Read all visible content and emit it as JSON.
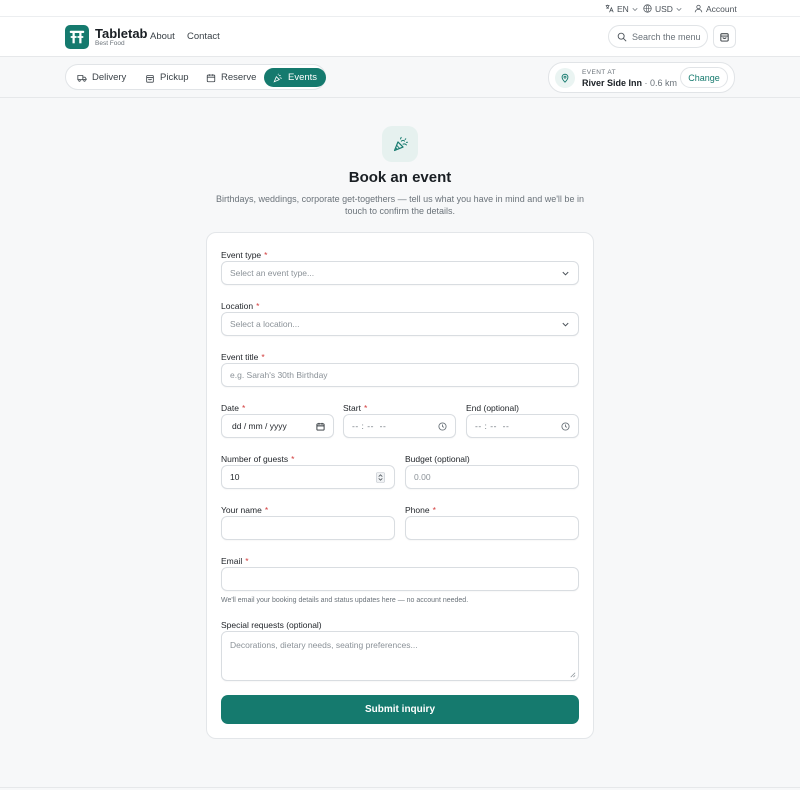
{
  "utility": {
    "language": "EN",
    "currency": "USD",
    "account": "Account"
  },
  "header": {
    "brand_name": "Tabletab",
    "brand_tagline": "Best Food",
    "nav": [
      "About",
      "Contact"
    ],
    "search_placeholder": "Search the menu"
  },
  "modes": {
    "tabs": [
      "Delivery",
      "Pickup",
      "Reserve",
      "Events"
    ],
    "active": "Events"
  },
  "location_card": {
    "label": "EVENT AT",
    "name": "River Side Inn",
    "distance": "· 0.6 km",
    "change_label": "Change"
  },
  "hero": {
    "title": "Book an event",
    "subtitle": "Birthdays, weddings, corporate get-togethers — tell us what you have in mind and we'll be in touch to confirm the details."
  },
  "form": {
    "event_type": {
      "label": "Event type",
      "placeholder": "Select an event type..."
    },
    "location": {
      "label": "Location",
      "placeholder": "Select a location..."
    },
    "event_title": {
      "label": "Event title",
      "placeholder": "e.g. Sarah's 30th Birthday"
    },
    "date": {
      "label": "Date",
      "placeholder": "dd / mm / yyyy"
    },
    "start": {
      "label": "Start",
      "placeholder": "-- : --  --"
    },
    "end": {
      "label": "End (optional)",
      "placeholder": "-- : --  --"
    },
    "guests": {
      "label": "Number of guests",
      "value": "10"
    },
    "budget": {
      "label": "Budget (optional)",
      "placeholder": "0.00"
    },
    "name": {
      "label": "Your name",
      "value": ""
    },
    "phone": {
      "label": "Phone",
      "value": ""
    },
    "email": {
      "label": "Email",
      "value": "",
      "hint": "We'll email your booking details and status updates here — no account needed."
    },
    "requests": {
      "label": "Special requests (optional)",
      "placeholder": "Decorations, dietary needs, seating preferences..."
    },
    "required_mark": "*",
    "submit_label": "Submit inquiry"
  },
  "colors": {
    "brand": "#157a6e",
    "required": "#d23c3c",
    "background": "#f7f8f9"
  }
}
